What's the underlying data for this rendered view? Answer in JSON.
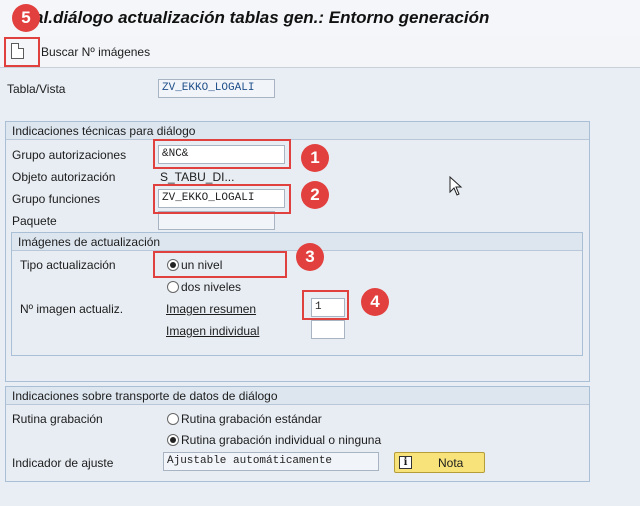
{
  "window": {
    "title": "tual.diálogo actualización tablas gen.: Entorno generación"
  },
  "toolbar": {
    "icon": "document-icon",
    "buscar_label": "Buscar Nº imágenes"
  },
  "table": {
    "label": "Tabla/Vista",
    "value": "ZV_EKKO_LOGALI"
  },
  "tech": {
    "title": "Indicaciones técnicas para diálogo",
    "auth_group_label": "Grupo autorizaciones",
    "auth_group_value": "&NC&",
    "auth_object_label": "Objeto autorización",
    "auth_object_value": "S_TABU_DI...",
    "func_group_label": "Grupo funciones",
    "func_group_value": "ZV_EKKO_LOGALI",
    "package_label": "Paquete",
    "package_value": ""
  },
  "images": {
    "title": "Imágenes de actualización",
    "type_label": "Tipo actualización",
    "opt_one": "un nivel",
    "opt_two": "dos niveles",
    "num_label": "Nº imagen actualiz.",
    "summary_label": "Imagen resumen",
    "summary_value": "1",
    "individual_label": "Imagen individual",
    "individual_value": ""
  },
  "transport": {
    "title": "Indicaciones sobre transporte de datos de diálogo",
    "routine_label": "Rutina grabación",
    "routine_std": "Rutina grabación estándar",
    "routine_ind": "Rutina grabación individual o ninguna",
    "adjust_label": "Indicador de ajuste",
    "adjust_value": "Ajustable automáticamente",
    "nota_label": "Nota",
    "nota_icon": "info-icon"
  },
  "annotations": [
    "1",
    "2",
    "3",
    "4",
    "5"
  ],
  "colors": {
    "annotation": "#e2403e",
    "note_button": "#f8e27a"
  }
}
